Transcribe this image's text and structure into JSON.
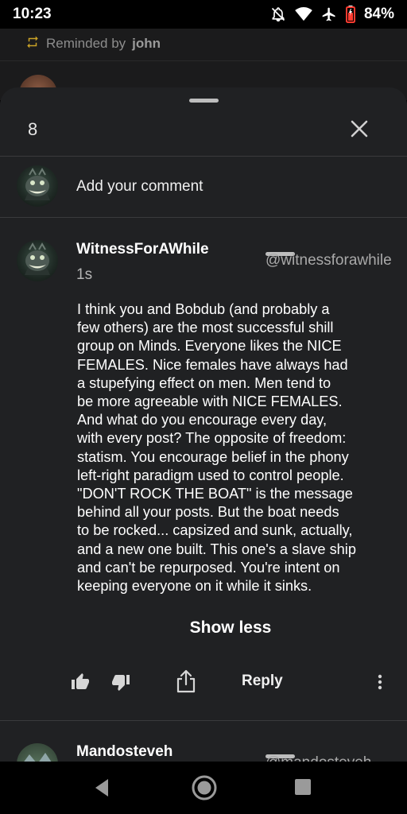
{
  "status_bar": {
    "time": "10:23",
    "battery": "84%",
    "icons": [
      "notifications-off-icon",
      "wifi-icon",
      "airplane-icon",
      "battery-icon"
    ]
  },
  "background_feed": {
    "reminded_prefix": "Reminded by",
    "reminded_user": "john"
  },
  "sheet": {
    "comment_count": "8",
    "add_comment_placeholder": "Add your comment",
    "comment": {
      "author_name": "WitnessForAWhile",
      "author_handle": "@witnessforawhile",
      "time": "1s",
      "lines": [
        "I think you and Bobdub (and probably a",
        "few others) are the most successful shill",
        "group on Minds. Everyone likes the NICE",
        "FEMALES. Nice females have always had",
        "a stupefying effect on men. Men tend to",
        "be more agreeable with NICE FEMALES.",
        "And what do you encourage every day,",
        "with every post? The opposite of freedom:",
        "statism. You encourage belief in the phony",
        "left-right paradigm used to control people.",
        "\"DON'T ROCK THE BOAT\" is the message",
        "behind all your posts. But the boat needs",
        "to be rocked... capsized and sunk, actually,",
        "and a new one built. This one's a slave ship",
        "and can't be repurposed. You're intent on",
        "keeping everyone on it while it sinks."
      ],
      "show_less_label": "Show less",
      "reply_label": "Reply"
    },
    "next_comment": {
      "author_name": "Mandosteveh",
      "author_handle": "@mandosteveh"
    }
  },
  "colors": {
    "sheet_bg": "#202123",
    "text_secondary": "#a9a9a9",
    "separator": "#3a3a3c"
  }
}
